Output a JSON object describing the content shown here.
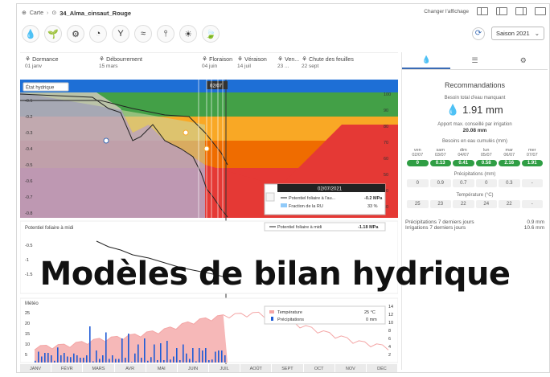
{
  "breadcrumb": {
    "root": "Carte",
    "field": "34_Alma_cinsaut_Rouge"
  },
  "toolbar": {
    "change_display": "Changer l'affichage"
  },
  "season": {
    "label": "Saison 2021"
  },
  "tools": [
    {
      "icon": "water-drop-icon",
      "glyph": "💧"
    },
    {
      "icon": "plant-icon",
      "glyph": "🌱"
    },
    {
      "icon": "sensor-icon",
      "glyph": "⚙"
    },
    {
      "icon": "gauge-icon",
      "glyph": "◔"
    },
    {
      "icon": "vine-icon",
      "glyph": "Y"
    },
    {
      "icon": "irrigation-icon",
      "glyph": "≈"
    },
    {
      "icon": "probe-icon",
      "glyph": "⫯"
    },
    {
      "icon": "sun-icon",
      "glyph": "☀"
    },
    {
      "icon": "leaf-icon",
      "glyph": "🍃"
    }
  ],
  "stages": [
    {
      "name": "Dormance",
      "date": "01 janv"
    },
    {
      "name": "Débourrement",
      "date": "15 mars"
    },
    {
      "name": "Floraison",
      "date": "04 juin"
    },
    {
      "name": "Véraison",
      "date": "14 juil"
    },
    {
      "name": "Ven...",
      "date": "23 ..."
    },
    {
      "name": "Chute des feuilles",
      "date": "22 sept"
    }
  ],
  "charts": {
    "state_label": "État hydrique",
    "date_marker": "02/07",
    "potential_label": "Potentiel foliaire à midi",
    "weather_label": "Météo",
    "tooltip": {
      "date": "02/07/2021",
      "rows": [
        {
          "label": "Potentiel foliaire à l'au...",
          "value": "-0.2 MPa"
        },
        {
          "label": "Fraction de la RU",
          "value": "33 %"
        }
      ],
      "potential_row": {
        "label": "Potentiel foliaire à midi",
        "value": "-1.18 MPa"
      },
      "weather_rows": [
        {
          "label": "Température",
          "value": "25 °C"
        },
        {
          "label": "Précipitations",
          "value": "0 mm"
        }
      ]
    }
  },
  "chart_data": [
    {
      "type": "area",
      "title": "État hydrique",
      "x": [
        "Jan",
        "Feb",
        "Mar",
        "Apr",
        "May",
        "Jun",
        "Jul",
        "Aug",
        "Sep",
        "Oct",
        "Nov",
        "Dec"
      ],
      "y_left_ticks": [
        -0.1,
        -0.2,
        -0.3,
        -0.4,
        -0.5,
        -0.6,
        -0.7,
        -0.8
      ],
      "y_right_ticks": [
        100,
        90,
        80,
        70,
        60,
        50,
        40,
        30,
        20
      ],
      "series": [
        {
          "name": "Potentiel foliaire à l'aube",
          "values": [
            -0.1,
            -0.12,
            -0.2,
            -0.35,
            -0.3,
            -0.35,
            -0.55,
            -0.7,
            -0.8,
            -0.75,
            -0.7,
            -0.7
          ]
        },
        {
          "name": "Fraction de la RU",
          "values": [
            95,
            93,
            90,
            80,
            75,
            60,
            33,
            20,
            10,
            10,
            10,
            10
          ]
        }
      ]
    },
    {
      "type": "line",
      "title": "Potentiel foliaire à midi",
      "y_ticks": [
        -0.5,
        -1.0,
        -1.5
      ],
      "series": [
        {
          "name": "Potentiel foliaire à midi",
          "values": [
            -0.5,
            -0.6,
            -0.7,
            -0.8,
            -0.9,
            -1.1,
            -1.2
          ]
        }
      ]
    },
    {
      "type": "bar",
      "title": "Météo",
      "y_left_ticks": [
        25,
        20,
        15,
        10,
        5
      ],
      "y_right_ticks": [
        14,
        12,
        10,
        8,
        6,
        4,
        2
      ],
      "series": [
        {
          "name": "Température",
          "values": [
            8,
            9,
            12,
            14,
            17,
            22,
            25,
            26,
            21,
            16,
            11,
            8
          ]
        },
        {
          "name": "Précipitations",
          "values": [
            3,
            6,
            2,
            8,
            4,
            12,
            1,
            5,
            6,
            4,
            10,
            3
          ]
        }
      ]
    }
  ],
  "months": [
    "JANV",
    "FÉVR",
    "MARS",
    "AVR",
    "MAI",
    "JUIN",
    "JUIL",
    "AOÛT",
    "SEPT",
    "OCT",
    "NOV",
    "DÉC"
  ],
  "panel": {
    "title": "Recommandations",
    "total_needs_label": "Besoin total d'eau manquant",
    "total_needs_value": "1.91 mm",
    "max_supply_label": "Apport max. conseillé par irrigation",
    "max_supply_value": "20.08 mm",
    "cumulative_label": "Besoins en eau cumulés (mm)",
    "days": [
      {
        "wd": "ven",
        "d": "02/07"
      },
      {
        "wd": "sam",
        "d": "03/07"
      },
      {
        "wd": "dim",
        "d": "04/07"
      },
      {
        "wd": "lun",
        "d": "05/07"
      },
      {
        "wd": "mar",
        "d": "06/07"
      },
      {
        "wd": "mer",
        "d": "07/07"
      }
    ],
    "needs": [
      "0",
      "0.13",
      "0.41",
      "0.58",
      "2.16",
      "1.91"
    ],
    "precip_label": "Précipitations (mm)",
    "precip": [
      "0",
      "0.9",
      "0.7",
      "0",
      "0.3",
      "-"
    ],
    "temp_label": "Température (°C)",
    "temp": [
      "25",
      "23",
      "22",
      "24",
      "22",
      "-"
    ],
    "summary": [
      {
        "label": "Précipitations 7 derniers jours",
        "value": "0.9 mm"
      },
      {
        "label": "Irrigations 7 derniers jours",
        "value": "10.6 mm"
      }
    ]
  },
  "overlay_title": "Modèles de bilan hydrique"
}
